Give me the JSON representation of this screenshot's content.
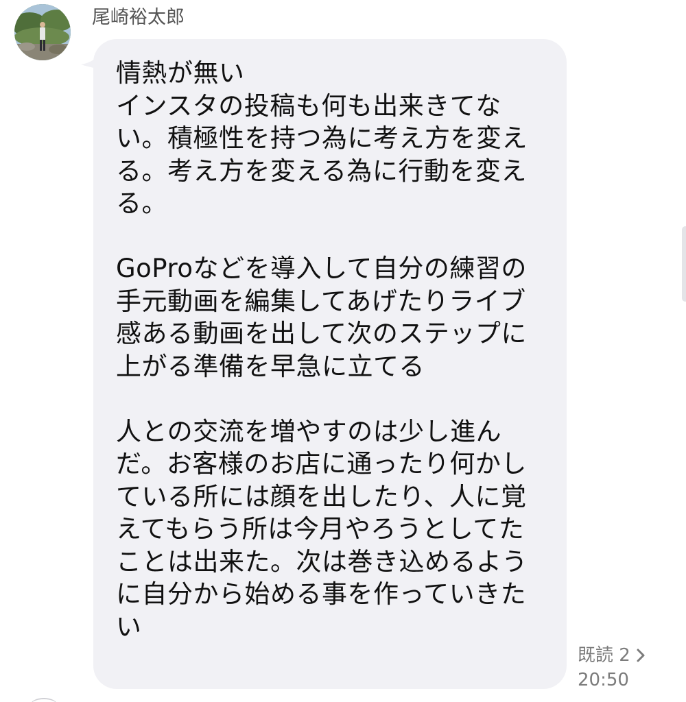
{
  "message": {
    "sender_name": "尾崎裕太郎",
    "text": "情熱が無い\nインスタの投稿も何も出来きてない。積極性を持つ為に考え方を変える。考え方を変える為に行動を変える。\n\nGoProなどを導入して自分の練習の手元動画を編集してあげたりライブ感ある動画を出して次のステップに上がる準備を早急に立てる\n\n人との交流を増やすのは少し進んだ。お客様のお店に通ったり何かしている所には顔を出したり、人に覚えてもらう所は今月やろうとしてたことは出来た。次は巻き込めるように自分から始める事を作っていきたい",
    "read_label": "既読 2",
    "time": "20:50"
  },
  "colors": {
    "bubble_bg": "#f1f1f5",
    "meta_text": "#7c7c7c",
    "name_text": "#555555"
  },
  "icons": {
    "avatar": "avatar-photo",
    "read_more": "chevron-right-icon"
  }
}
